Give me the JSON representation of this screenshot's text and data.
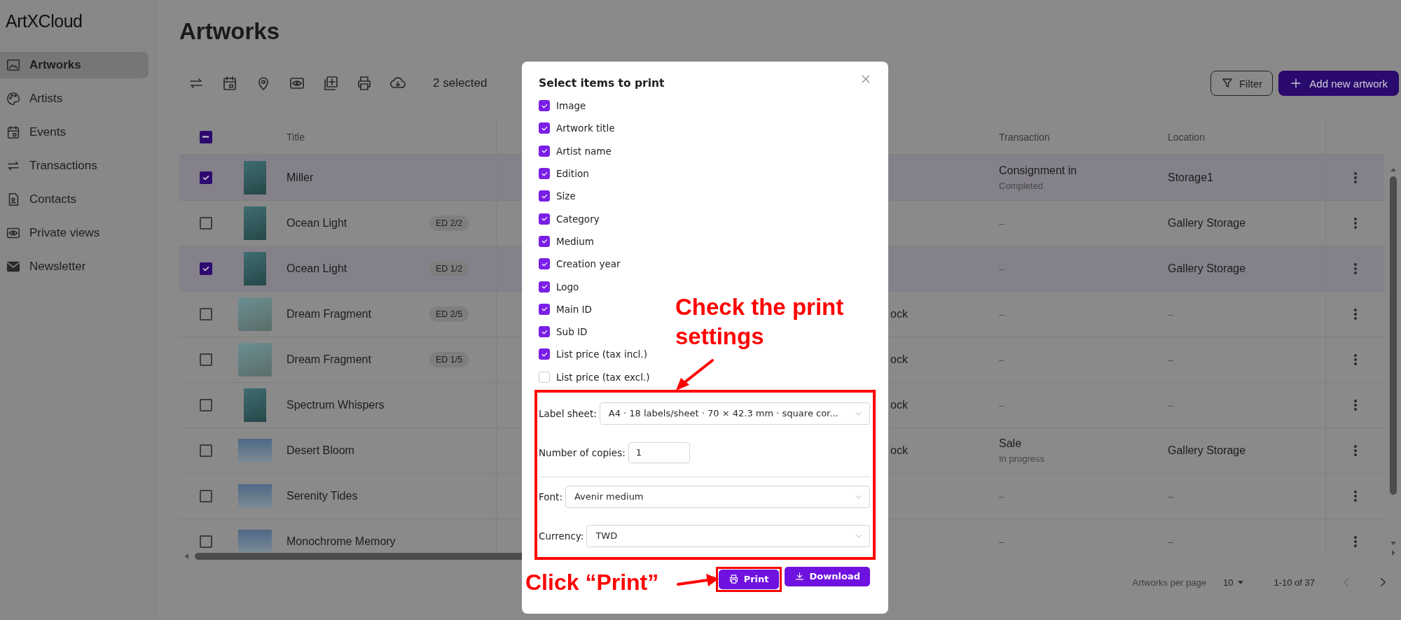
{
  "logo": "ArtXCloud",
  "sidebar": {
    "items": [
      {
        "label": "Artworks",
        "selected": true
      },
      {
        "label": "Artists",
        "selected": false
      },
      {
        "label": "Events",
        "selected": false
      },
      {
        "label": "Transactions",
        "selected": false
      },
      {
        "label": "Contacts",
        "selected": false
      },
      {
        "label": "Private views",
        "selected": false
      },
      {
        "label": "Newsletter",
        "selected": false
      }
    ]
  },
  "page_title": "Artworks",
  "toolbar": {
    "selected_count": "2 selected",
    "filter_button": "Filter",
    "add_button": "Add new artwork"
  },
  "table": {
    "select_all": {
      "indeterminate": true
    },
    "columns": [
      {
        "label": "Title"
      },
      {
        "label": "Transaction"
      },
      {
        "label": "Location"
      }
    ],
    "rows": [
      {
        "title": "Miller",
        "selected": true,
        "transaction": "Consignment in",
        "transaction_status": "Completed",
        "location": "Storage1"
      },
      {
        "title": "Ocean Light",
        "edition": "ED 2/2",
        "selected": false,
        "transaction": "–",
        "location": "Gallery Storage"
      },
      {
        "title": "Ocean Light",
        "edition": "ED 1/2",
        "selected": true,
        "transaction": "–",
        "location": "Gallery Storage"
      },
      {
        "title": "Dream Fragment",
        "edition": "ED 2/5",
        "selected": false,
        "column_5": "ock",
        "transaction": "–",
        "location": "–"
      },
      {
        "title": "Dream Fragment",
        "edition": "ED 1/5",
        "selected": false,
        "column_5": "ock",
        "transaction": "–",
        "location": "–"
      },
      {
        "title": "Spectrum Whispers",
        "selected": false,
        "column_5": "ock",
        "transaction": "–",
        "location": "–"
      },
      {
        "title": "Desert Bloom",
        "selected": false,
        "column_5": "ock",
        "transaction": "Sale",
        "transaction_status": "In progress",
        "location": "Gallery Storage"
      },
      {
        "title": "Serenity Tides",
        "selected": false,
        "transaction": "–",
        "location": "–"
      },
      {
        "title": "Monochrome Memory",
        "selected": false,
        "transaction": "–",
        "location": "–"
      }
    ]
  },
  "pagination": {
    "per_page_label": "Artworks per page",
    "per_page": "10",
    "range": "1-10 of 37"
  },
  "dialog": {
    "title": "Select items to print",
    "items": [
      {
        "label": "Image",
        "checked": true
      },
      {
        "label": "Artwork title",
        "checked": true
      },
      {
        "label": "Artist name",
        "checked": true
      },
      {
        "label": "Edition",
        "checked": true
      },
      {
        "label": "Size",
        "checked": true
      },
      {
        "label": "Category",
        "checked": true
      },
      {
        "label": "Medium",
        "checked": true
      },
      {
        "label": "Creation year",
        "checked": true
      },
      {
        "label": "Logo",
        "checked": true
      },
      {
        "label": "Main ID",
        "checked": true
      },
      {
        "label": "Sub ID",
        "checked": true
      },
      {
        "label": "List price (tax incl.)",
        "checked": true
      },
      {
        "label": "List price (tax excl.)",
        "checked": false
      }
    ],
    "label_sheet": {
      "label": "Label sheet:",
      "value": "A4 · 18 labels/sheet · 70 × 42.3 mm · square cor..."
    },
    "copies": {
      "label": "Number of copies:",
      "value": "1"
    },
    "font": {
      "label": "Font:",
      "value": "Avenir medium"
    },
    "currency": {
      "label": "Currency:",
      "value": "TWD"
    },
    "buttons": [
      {
        "label": "Print",
        "kind": "print"
      },
      {
        "label": "Download",
        "kind": "download"
      }
    ]
  },
  "annotations": [
    {
      "kind": "settings",
      "text": "Check the print settings"
    },
    {
      "kind": "print",
      "text": "Click “Print”"
    }
  ]
}
